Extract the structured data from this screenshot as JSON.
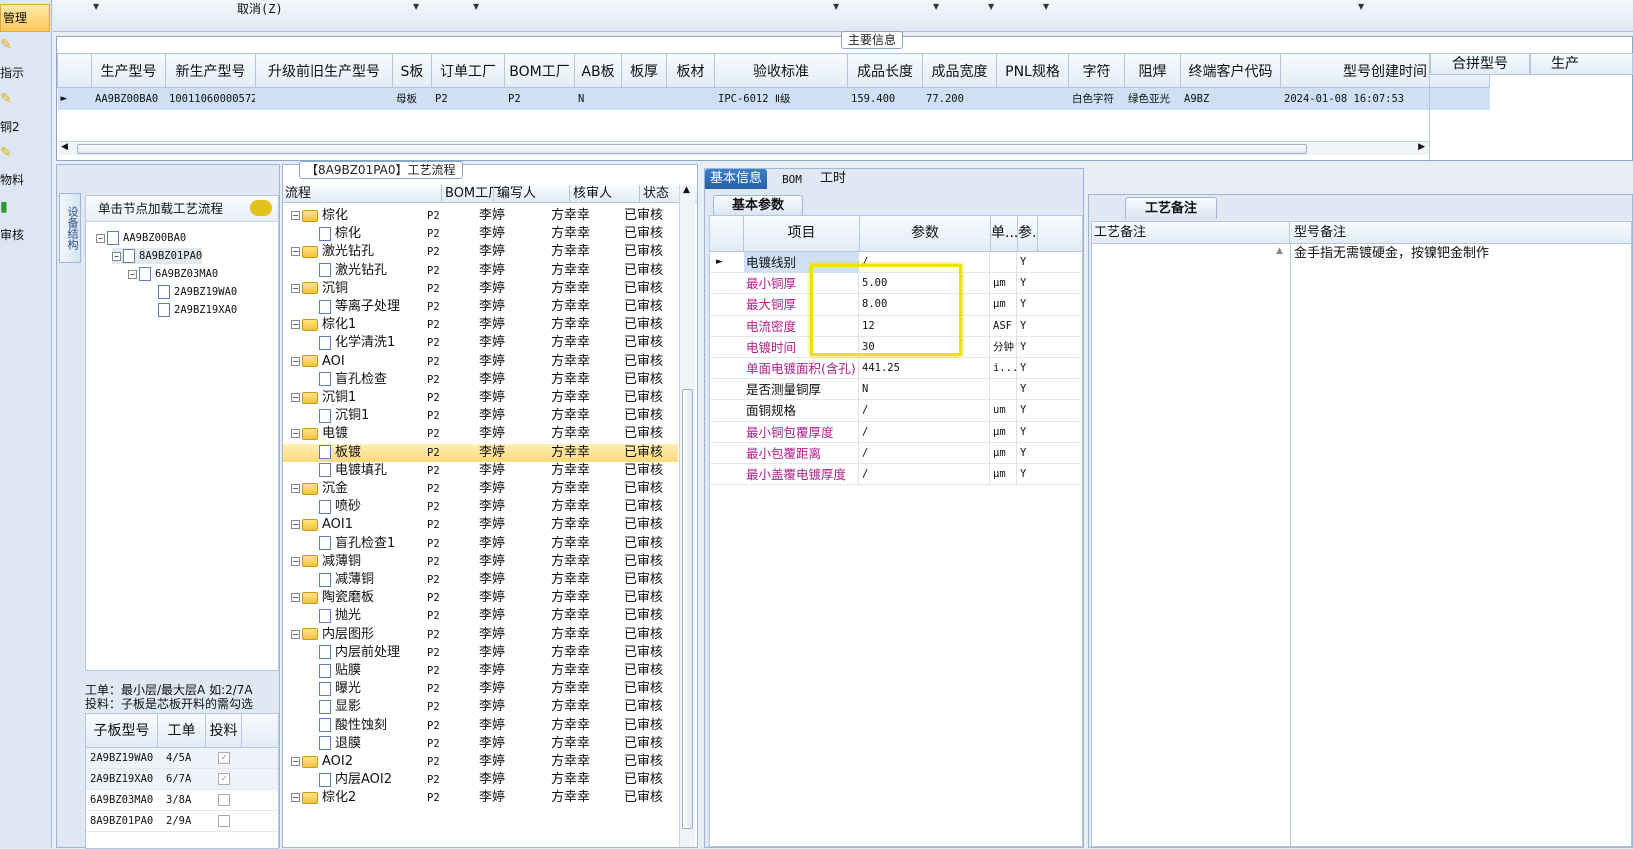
{
  "nav": {
    "active_label": "管理",
    "items": [
      "指示",
      "铜2",
      "物料",
      "审核"
    ]
  },
  "toolbar": {
    "cancel_label": "取消(Z)"
  },
  "main_info": {
    "legend": "主要信息",
    "columns": [
      "生产型号",
      "新生产型号",
      "升级前旧生产型号",
      "S板",
      "订单工厂",
      "BOM工厂",
      "AB板",
      "板厚",
      "板材",
      "验收标准",
      "成品长度",
      "成品宽度",
      "PNL规格",
      "字符",
      "阻焊",
      "终端客户代码",
      "型号创建时间"
    ],
    "row": [
      "AA9BZ00BA0",
      "10011060000572",
      "",
      "母板",
      "P2",
      "P2",
      "N",
      "",
      "",
      "IPC-6012 Ⅱ级",
      "159.400",
      "77.200",
      "",
      "白色字符",
      "绿色亚光",
      "A9BZ",
      "2024-01-08 16:07:53"
    ],
    "right_columns": [
      "合拼型号",
      "生产"
    ]
  },
  "structure_panel": {
    "side_tab": "设备结构",
    "hint": "单击节点加载工艺流程",
    "tree": [
      "AA9BZ00BA0",
      "8A9BZ01PA0",
      "6A9BZ03MA0",
      "2A9BZ19WA0",
      "2A9BZ19XA0"
    ],
    "note_line1": "工单：最小层/最大层A 如:2/7A",
    "note_line2": "投料：子板是芯板开料的需勾选",
    "sub_columns": [
      "子板型号",
      "工单",
      "投料"
    ],
    "sub_rows": [
      {
        "model": "2A9BZ19WA0",
        "order": "4/5A",
        "checked": true
      },
      {
        "model": "2A9BZ19XA0",
        "order": "6/7A",
        "checked": true
      },
      {
        "model": "6A9BZ03MA0",
        "order": "3/8A",
        "checked": false
      },
      {
        "model": "8A9BZ01PA0",
        "order": "2/9A",
        "checked": false
      }
    ]
  },
  "process_panel": {
    "title": "【8A9BZ01PA0】工艺流程",
    "columns": [
      "流程",
      "BOM工厂",
      "编写人",
      "核审人",
      "状态"
    ],
    "factory": "P2",
    "writer": "李婷",
    "reviewer": "方幸幸",
    "status": "已审核",
    "rows": [
      {
        "name": "棕化",
        "level": 0
      },
      {
        "name": "棕化",
        "level": 1
      },
      {
        "name": "激光钻孔",
        "level": 0
      },
      {
        "name": "激光钻孔",
        "level": 1
      },
      {
        "name": "沉铜",
        "level": 0
      },
      {
        "name": "等离子处理",
        "level": 1
      },
      {
        "name": "棕化1",
        "level": 0
      },
      {
        "name": "化学清洗1",
        "level": 1
      },
      {
        "name": "AOI",
        "level": 0
      },
      {
        "name": "盲孔检查",
        "level": 1
      },
      {
        "name": "沉铜1",
        "level": 0
      },
      {
        "name": "沉铜1",
        "level": 1
      },
      {
        "name": "电镀",
        "level": 0
      },
      {
        "name": "板镀",
        "level": 1,
        "selected": true
      },
      {
        "name": "电镀填孔",
        "level": 1
      },
      {
        "name": "沉金",
        "level": 0
      },
      {
        "name": "喷砂",
        "level": 1
      },
      {
        "name": "AOI1",
        "level": 0
      },
      {
        "name": "盲孔检查1",
        "level": 1
      },
      {
        "name": "减薄铜",
        "level": 0
      },
      {
        "name": "减薄铜",
        "level": 1
      },
      {
        "name": "陶瓷磨板",
        "level": 0
      },
      {
        "name": "抛光",
        "level": 1
      },
      {
        "name": "内层图形",
        "level": 0
      },
      {
        "name": "内层前处理",
        "level": 1
      },
      {
        "name": "贴膜",
        "level": 1
      },
      {
        "name": "曝光",
        "level": 1
      },
      {
        "name": "显影",
        "level": 1
      },
      {
        "name": "酸性蚀刻",
        "level": 1
      },
      {
        "name": "退膜",
        "level": 1
      },
      {
        "name": "AOI2",
        "level": 0
      },
      {
        "name": "内层AOI2",
        "level": 1
      },
      {
        "name": "棕化2",
        "level": 0
      }
    ]
  },
  "detail_panel": {
    "tabs": [
      "基本信息",
      "BOM",
      "工时"
    ],
    "subtab": "基本参数",
    "columns": [
      "项目",
      "参数",
      "单...",
      "参..."
    ],
    "rows": [
      {
        "name": "电镀线别",
        "value": "/",
        "unit": "",
        "req": "Y",
        "color": "normal"
      },
      {
        "name": "最小铜厚",
        "value": "5.00",
        "unit": "μm",
        "req": "Y",
        "color": "magenta"
      },
      {
        "name": "最大铜厚",
        "value": "8.00",
        "unit": "μm",
        "req": "Y",
        "color": "magenta"
      },
      {
        "name": "电流密度",
        "value": "12",
        "unit": "ASF",
        "req": "Y",
        "color": "magenta"
      },
      {
        "name": "电镀时间",
        "value": "30",
        "unit": "分钟",
        "req": "Y",
        "color": "magenta"
      },
      {
        "name": "单面电镀面积(含孔)",
        "value": "441.25",
        "unit": "i...",
        "req": "Y",
        "color": "magenta"
      },
      {
        "name": "是否测量铜厚",
        "value": "N",
        "unit": "",
        "req": "Y",
        "color": "normal"
      },
      {
        "name": "面铜规格",
        "value": "/",
        "unit": "um",
        "req": "Y",
        "color": "normal"
      },
      {
        "name": "最小铜包覆厚度",
        "value": "/",
        "unit": "μm",
        "req": "Y",
        "color": "magenta"
      },
      {
        "name": "最小包覆距离",
        "value": "/",
        "unit": "μm",
        "req": "Y",
        "color": "magenta"
      },
      {
        "name": "最小盖覆电镀厚度",
        "value": "/",
        "unit": "μm",
        "req": "Y",
        "color": "magenta"
      }
    ]
  },
  "remarks_panel": {
    "tab": "工艺备注",
    "col1": "工艺备注",
    "col2": "型号备注",
    "model_remark": "金手指无需镀硬金，按镍钯金制作"
  },
  "colors": {
    "magenta": "#b0208c",
    "highlight": "#f0e010",
    "selection": "#cfe0f5"
  }
}
